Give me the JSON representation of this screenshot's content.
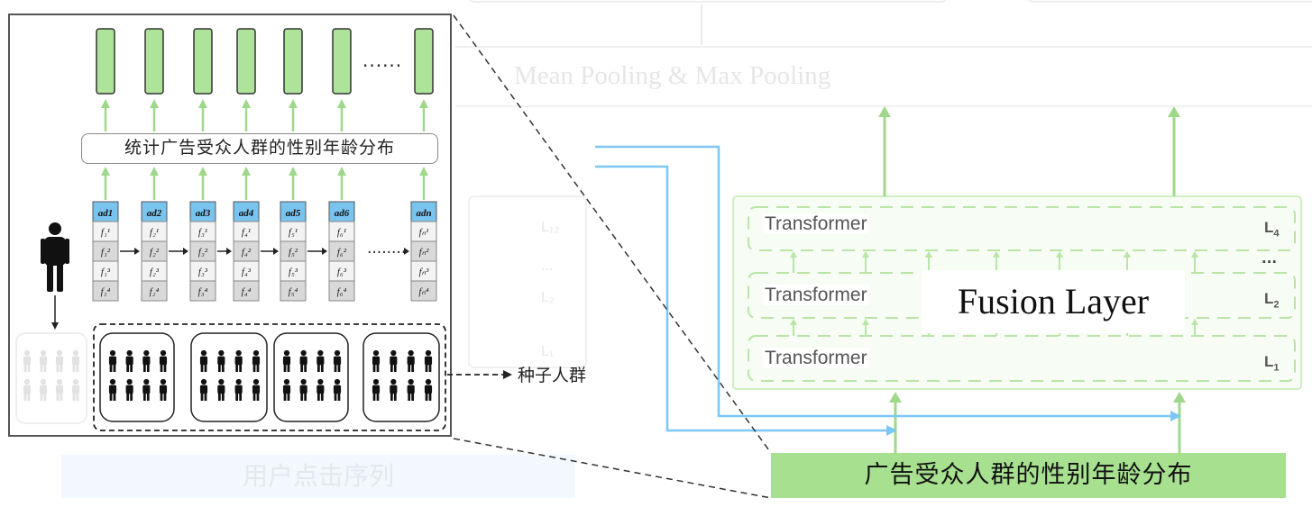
{
  "diagram": {
    "pooling_label": "Mean Pooling & Max Pooling",
    "click_sequence_label": "用户点击序列",
    "stats_box_label": "统计广告受众人群的性别年龄分布",
    "seed_crowd_label": "种子人群",
    "output_label": "广告受众人群的性别年龄分布",
    "fusion_layer_label": "Fusion Layer",
    "ellipsis_top": "......",
    "ellipsis_mid": "········",
    "transformers": [
      {
        "label": "Transformer",
        "layer": "L",
        "sub": "4"
      },
      {
        "label": "Transformer",
        "layer": "L",
        "sub": "2"
      },
      {
        "label": "Transformer",
        "layer": "L",
        "sub": "1"
      }
    ],
    "layer_ellipsis": "...",
    "ads": [
      {
        "head": "ad",
        "sub": "1",
        "feats": [
          "f₁¹",
          "f₁²",
          "f₁³",
          "f₁⁴"
        ]
      },
      {
        "head": "ad",
        "sub": "2",
        "feats": [
          "f₂¹",
          "f₂²",
          "f₂³",
          "f₂⁴"
        ]
      },
      {
        "head": "ad",
        "sub": "3",
        "feats": [
          "f₃¹",
          "f₃²",
          "f₃³",
          "f₃⁴"
        ]
      },
      {
        "head": "ad",
        "sub": "4",
        "feats": [
          "f₄¹",
          "f₄²",
          "f₄³",
          "f₄⁴"
        ]
      },
      {
        "head": "ad",
        "sub": "5",
        "feats": [
          "f₅¹",
          "f₅²",
          "f₅³",
          "f₅⁴"
        ]
      },
      {
        "head": "ad",
        "sub": "6",
        "feats": [
          "f₆¹",
          "f₆²",
          "f₆³",
          "f₆⁴"
        ]
      },
      {
        "head": "ad",
        "sub": "n",
        "feats": [
          "fₙ¹",
          "fₙ²",
          "fₙ³",
          "fₙ⁴"
        ]
      }
    ],
    "colors": {
      "green_bar": "#aee39a",
      "green_arrow": "#9fd88a",
      "ad_header": "#79c3ef",
      "blue_arrow": "#7cc7f5",
      "output_bg": "#a7e08f"
    }
  }
}
